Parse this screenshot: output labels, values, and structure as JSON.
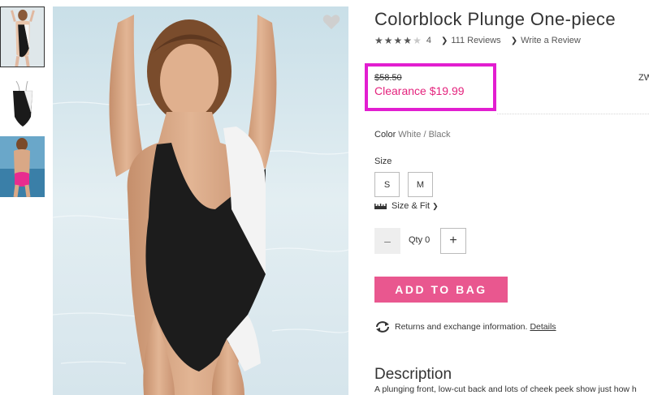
{
  "product": {
    "title": "Colorblock Plunge One-piece",
    "rating": 4,
    "rating_value": "4",
    "reviews_label": "111 Reviews",
    "write_review_label": "Write a Review"
  },
  "price": {
    "original": "$58.50",
    "clearance": "Clearance $19.99",
    "highlight_color": "#e21ed0",
    "clearance_color": "#e4237d"
  },
  "partial_right_text": "ZW",
  "color": {
    "label": "Color",
    "value": "White / Black"
  },
  "size": {
    "label": "Size",
    "options": [
      "S",
      "M"
    ],
    "fit_label": "Size & Fit"
  },
  "quantity": {
    "label": "Qty 0",
    "minus_icon": "minus-icon",
    "plus_icon": "plus-icon"
  },
  "cart": {
    "add_label": "ADD TO BAG",
    "button_color": "#e9578f"
  },
  "returns": {
    "text": "Returns and exchange information.",
    "details_label": "Details",
    "icon": "refresh-icon"
  },
  "description": {
    "title": "Description",
    "text": "A plunging front, low-cut back and lots of cheek peek show just how h"
  },
  "icons": {
    "favorite": "heart-icon",
    "size_fit": "ruler-icon"
  },
  "thumbnails": [
    "front-view",
    "flat-view",
    "back-view"
  ]
}
